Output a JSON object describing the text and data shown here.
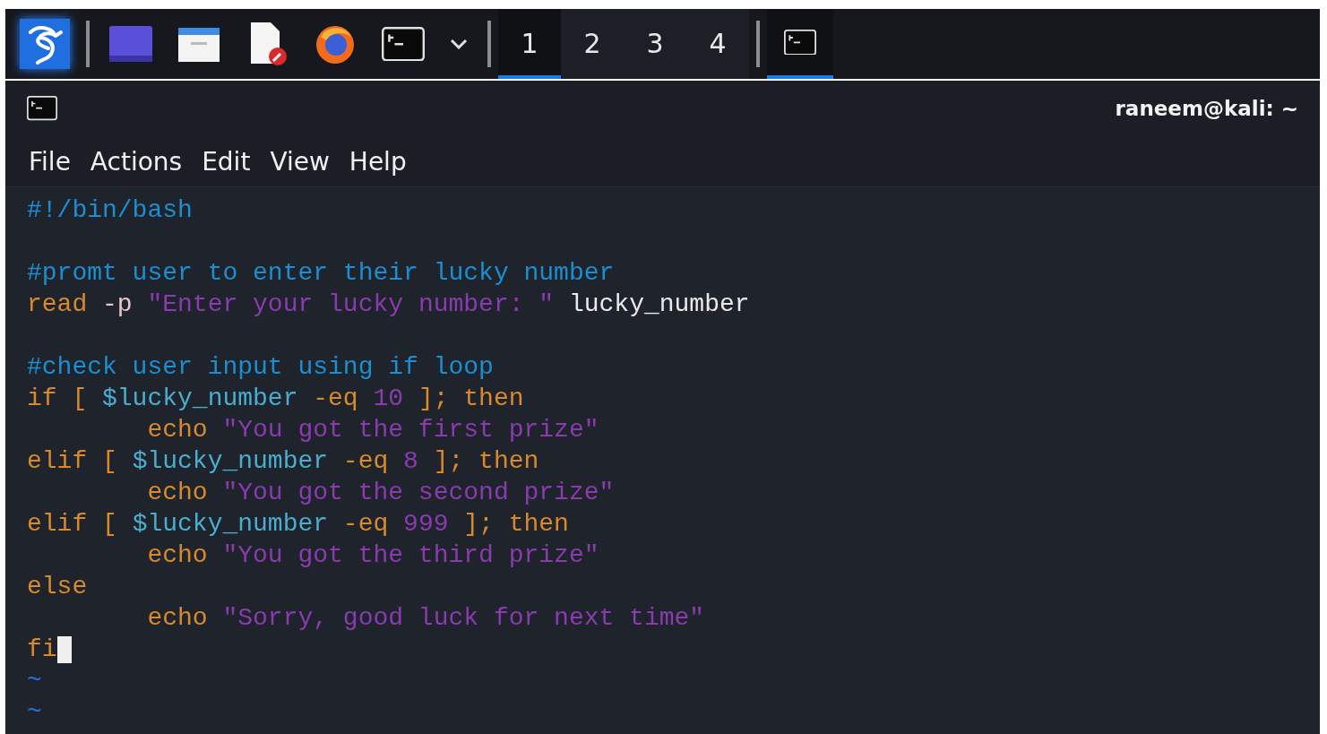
{
  "taskbar": {
    "workspaces": [
      {
        "label": "1",
        "selected": true
      },
      {
        "label": "2",
        "selected": false
      },
      {
        "label": "3",
        "selected": false
      },
      {
        "label": "4",
        "selected": false
      }
    ],
    "window_button": {
      "selected": true
    }
  },
  "window": {
    "title": "raneem@kali: ~"
  },
  "menu": [
    "File",
    "Actions",
    "Edit",
    "View",
    "Help"
  ],
  "editor": {
    "lines": [
      {
        "kind": "code",
        "tokens": [
          {
            "kind": "comment",
            "text": "#!/bin/bash"
          }
        ]
      },
      {
        "kind": "blank"
      },
      {
        "kind": "code",
        "tokens": [
          {
            "kind": "comment",
            "text": "#promt user to enter their lucky number"
          }
        ]
      },
      {
        "kind": "code",
        "tokens": [
          {
            "kind": "keyword",
            "text": "read"
          },
          {
            "kind": "option",
            "text": " -p "
          },
          {
            "kind": "string",
            "text": "\"Enter your lucky number: \""
          },
          {
            "kind": "plain",
            "text": " lucky_number"
          }
        ]
      },
      {
        "kind": "blank"
      },
      {
        "kind": "code",
        "tokens": [
          {
            "kind": "comment",
            "text": "#check user input using if loop"
          }
        ]
      },
      {
        "kind": "code",
        "tokens": [
          {
            "kind": "keyword",
            "text": "if [ "
          },
          {
            "kind": "variable",
            "text": "$lucky_number"
          },
          {
            "kind": "keyword",
            "text": " -eq "
          },
          {
            "kind": "number",
            "text": "10"
          },
          {
            "kind": "keyword",
            "text": " ]; then"
          }
        ]
      },
      {
        "kind": "code",
        "tokens": [
          {
            "kind": "keyword",
            "text": "\techo "
          },
          {
            "kind": "string",
            "text": "\"You got the first prize\""
          }
        ]
      },
      {
        "kind": "code",
        "tokens": [
          {
            "kind": "keyword",
            "text": "elif [ "
          },
          {
            "kind": "variable",
            "text": "$lucky_number"
          },
          {
            "kind": "keyword",
            "text": " -eq "
          },
          {
            "kind": "number",
            "text": "8"
          },
          {
            "kind": "keyword",
            "text": " ]; then"
          }
        ]
      },
      {
        "kind": "code",
        "tokens": [
          {
            "kind": "keyword",
            "text": "\techo "
          },
          {
            "kind": "string",
            "text": "\"You got the second prize\""
          }
        ]
      },
      {
        "kind": "code",
        "tokens": [
          {
            "kind": "keyword",
            "text": "elif [ "
          },
          {
            "kind": "variable",
            "text": "$lucky_number"
          },
          {
            "kind": "keyword",
            "text": " -eq "
          },
          {
            "kind": "number",
            "text": "999"
          },
          {
            "kind": "keyword",
            "text": " ]; then"
          }
        ]
      },
      {
        "kind": "code",
        "tokens": [
          {
            "kind": "keyword",
            "text": "\techo "
          },
          {
            "kind": "string",
            "text": "\"You got the third prize\""
          }
        ]
      },
      {
        "kind": "code",
        "tokens": [
          {
            "kind": "keyword",
            "text": "else"
          }
        ]
      },
      {
        "kind": "code",
        "tokens": [
          {
            "kind": "keyword",
            "text": "\techo "
          },
          {
            "kind": "string",
            "text": "\"Sorry, good luck for next time\""
          }
        ]
      },
      {
        "kind": "code",
        "cursor": true,
        "tokens": [
          {
            "kind": "keyword",
            "text": "fi"
          }
        ]
      }
    ],
    "filler_lines": [
      "~",
      "~"
    ]
  }
}
